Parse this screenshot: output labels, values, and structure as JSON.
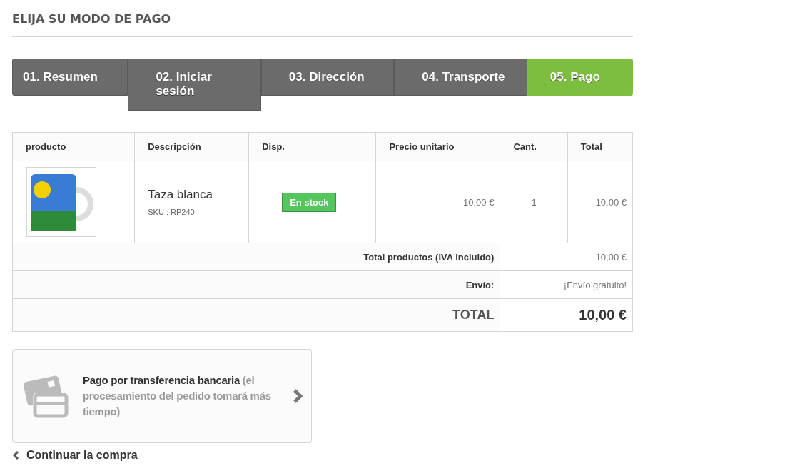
{
  "page_title": "ELIJA SU MODO DE PAGO",
  "steps": [
    {
      "label": "01. Resumen",
      "selected": false
    },
    {
      "label": "02. Iniciar sesión",
      "selected": false
    },
    {
      "label": "03. Dirección",
      "selected": false
    },
    {
      "label": "04. Transporte",
      "selected": false
    },
    {
      "label": "05. Pago",
      "selected": true
    }
  ],
  "table": {
    "columns": [
      "producto",
      "Descripción",
      "Disp.",
      "Precio unitario",
      "Cant.",
      "Total"
    ],
    "rows": [
      {
        "name": "Taza blanca",
        "sku": "SKU : RP240",
        "availability": "En stock",
        "unit_price": "10,00 €",
        "quantity": "1",
        "total": "10,00 €"
      }
    ],
    "summary": [
      {
        "kind": "normal",
        "label": "Total productos (IVA incluido)",
        "value": "10,00 €"
      },
      {
        "kind": "normal",
        "label": "Envío:",
        "value": "¡Envío gratuito!"
      },
      {
        "kind": "total",
        "label": "TOTAL",
        "value": "10,00 €"
      }
    ]
  },
  "payment_option": {
    "text": "**Pago por transferencia bancaria** (el procesamiento del pedido tomará más tiempo)"
  },
  "continue_link": "Continuar la compra"
}
